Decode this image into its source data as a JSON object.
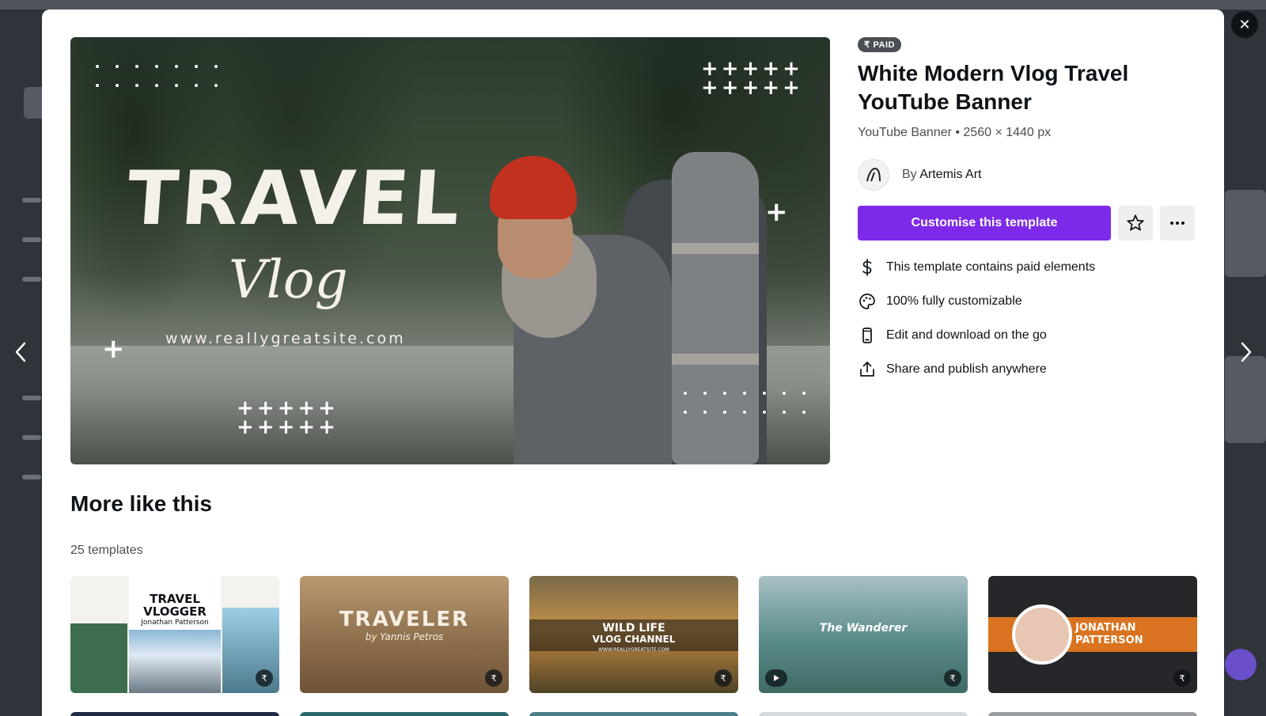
{
  "modal": {
    "close_label": "✕",
    "prev_label": "Previous template",
    "next_label": "Next template"
  },
  "preview": {
    "headline": "TRAVEL",
    "subline": "Vlog",
    "site": "www.reallygreatsite.com",
    "plus_rows": [
      "+++++",
      "+++++"
    ],
    "single_plus": "+"
  },
  "template": {
    "badge": "PAID",
    "badge_currency": "₹",
    "title": "White Modern Vlog Travel YouTube Banner",
    "meta": "YouTube Banner • 2560 × 1440 px",
    "author_prefix": "By",
    "author_name": "Artemis Art",
    "cta_label": "Customise this template"
  },
  "features": [
    {
      "icon": "dollar-icon",
      "label": "This template contains paid elements"
    },
    {
      "icon": "palette-icon",
      "label": "100% fully customizable"
    },
    {
      "icon": "phone-icon",
      "label": "Edit and download on the go"
    },
    {
      "icon": "share-icon",
      "label": "Share and publish anywhere"
    }
  ],
  "more": {
    "title": "More like this",
    "count": "25 templates"
  },
  "thumbnails": [
    {
      "line1": "TRAVEL",
      "line2": "VLOGGER",
      "line3": "Jonathan Patterson",
      "badge": "₹"
    },
    {
      "line1": "TRAVELER",
      "line2": "by Yannis Petros",
      "badge": "₹"
    },
    {
      "line1": "WILD LIFE",
      "line2": "VLOG CHANNEL",
      "line3": "WWW.REALLYGREATSITE.COM",
      "badge": "₹"
    },
    {
      "line1": "The Wanderer",
      "badge": "₹"
    },
    {
      "line1": "JONATHAN",
      "line2": "PATTERSON",
      "badge": "₹"
    }
  ],
  "colors": {
    "accent": "#7d2ae8",
    "text": "#0e1318",
    "muted": "#4a4f55"
  }
}
